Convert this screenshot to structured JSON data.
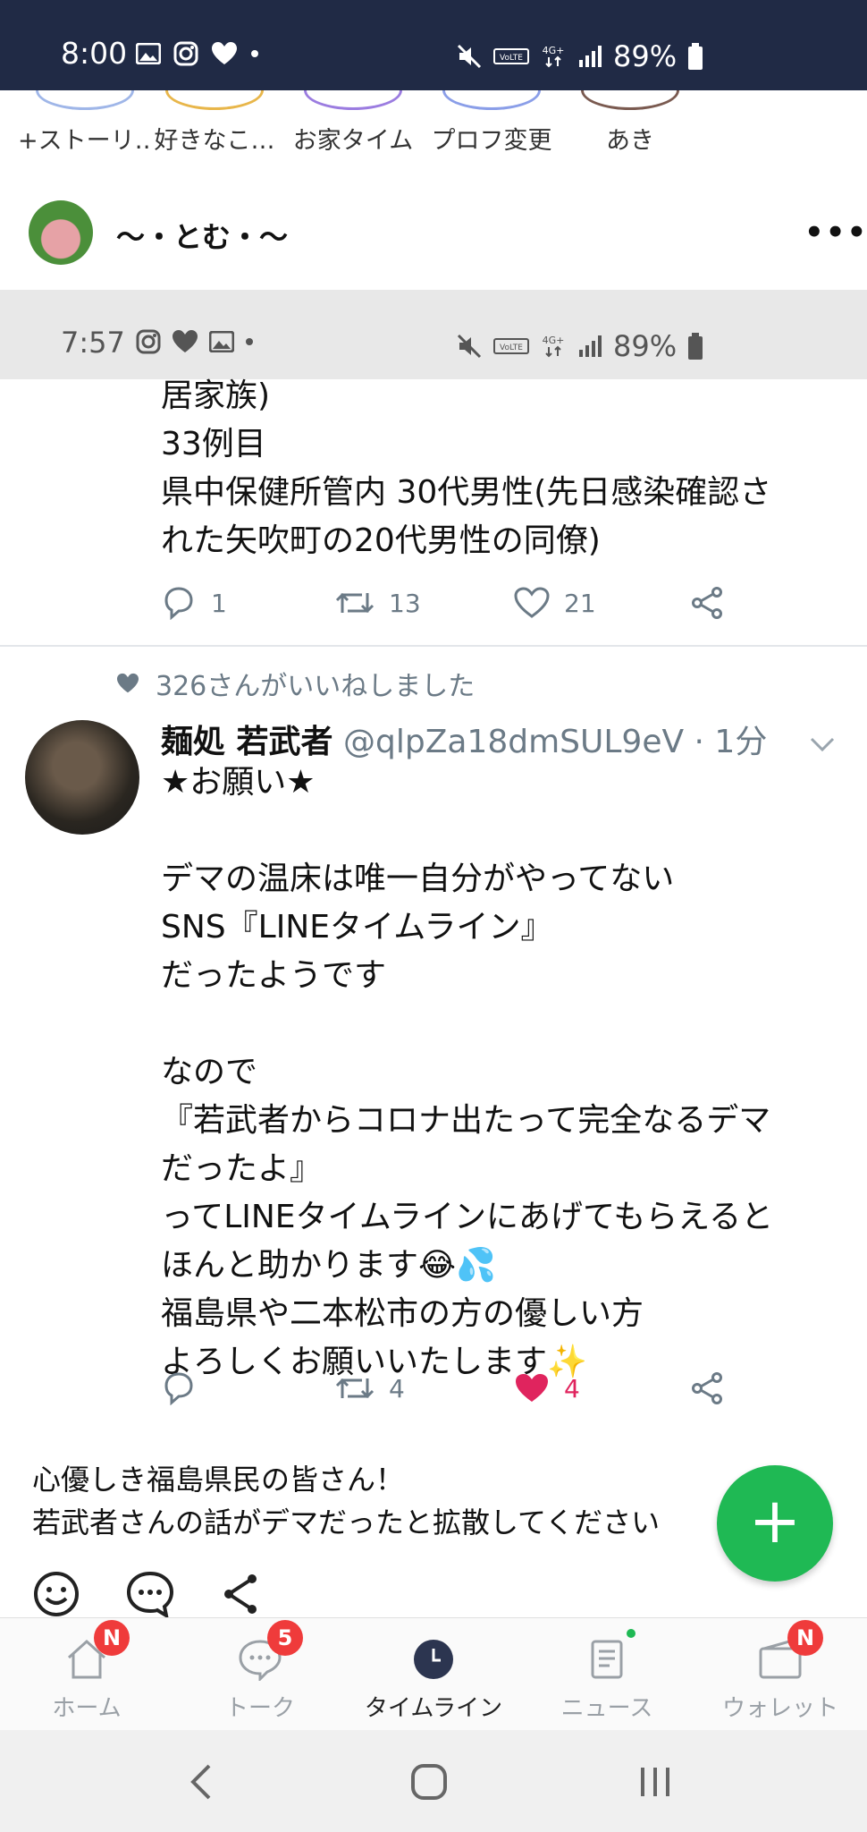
{
  "status_bar": {
    "time": "8:00",
    "battery": "89%"
  },
  "stories": [
    {
      "label": "+ストーリ…"
    },
    {
      "label": "好きなこ…"
    },
    {
      "label": "お家タイム"
    },
    {
      "label": "プロフ変更"
    },
    {
      "label": "あき"
    }
  ],
  "post": {
    "author": "〜・とむ・〜",
    "more": "•••"
  },
  "screenshot": {
    "status_time": "7:57",
    "status_battery": "89%",
    "tweet1": {
      "text": "居家族)\n33例目\n県中保健所管内 30代男性(先日感染確認さ\nれた矢吹町の20代男性の同僚)",
      "replies": "1",
      "retweets": "13",
      "likes": "21"
    },
    "liked_by": "326さんがいいねしました",
    "tweet2": {
      "name": "麺処 若武者",
      "handle": "@qlpZa18dmSUL9eV · 1分",
      "text": "★お願い★\n\nデマの温床は唯一自分がやってない\nSNS『LINEタイムライン』\nだったようです\n\nなので\n『若武者からコロナ出たって完全なるデマ\nだったよ』\nってLINEタイムラインにあげてもらえると\nほんと助かります😂💦\n福島県や二本松市の方の優しい方\nよろしくお願いいたします✨",
      "replies": "",
      "retweets": "4",
      "likes": "4"
    }
  },
  "caption": "心優しき福島県民の皆さん！\n若武者さんの話がデマだったと拡散してください",
  "fab": "+",
  "tabs": [
    {
      "label": "ホーム",
      "badge": "N"
    },
    {
      "label": "トーク",
      "badge": "5"
    },
    {
      "label": "タイムライン",
      "badge": ""
    },
    {
      "label": "ニュース",
      "badge": ""
    },
    {
      "label": "ウォレット",
      "badge": "N"
    }
  ],
  "colors": {
    "status_bg": "#202a45",
    "line_green": "#1fb954",
    "badge_red": "#ef3b3b",
    "like_red": "#e0245e"
  }
}
